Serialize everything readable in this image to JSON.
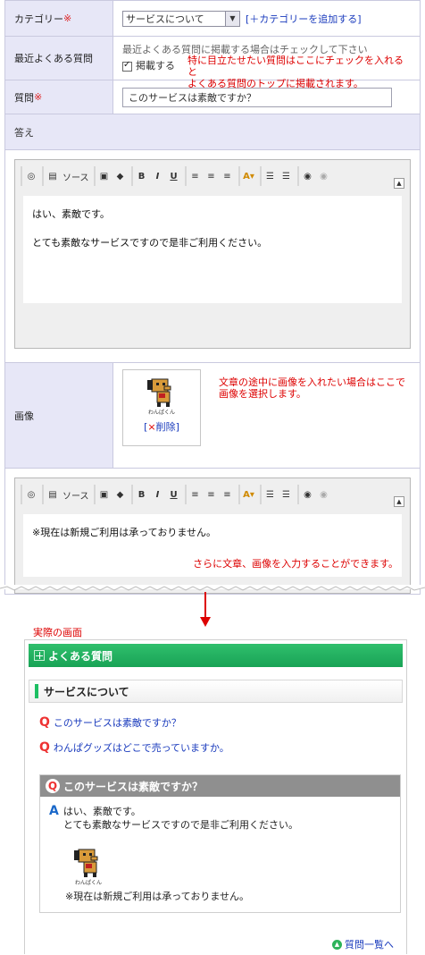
{
  "admin": {
    "category": {
      "label": "カテゴリー",
      "required": "※",
      "selected": "サービスについて",
      "add_link": "[＋カテゴリーを追加する]"
    },
    "recent": {
      "label": "最近よくある質問",
      "hint": "最近よくある質問に掲載する場合はチェックして下さい",
      "checkbox_label": "掲載する",
      "annotation_line1": "特に目立たせたい質問はここにチェックを入れると",
      "annotation_line2": "よくある質問のトップに掲載されます。"
    },
    "question": {
      "label": "質問",
      "required": "※",
      "value": "このサービスは素敵ですか？"
    },
    "answer": {
      "label": "答え"
    },
    "editor1": {
      "source_label": "ソース",
      "line1": "はい、素敵です。",
      "line2": "とても素敵なサービスですので是非ご利用ください。"
    },
    "image": {
      "label": "画像",
      "caption": "わんぱくん",
      "delete_label": "削除",
      "delete_x": "×",
      "annotation_line1": "文章の途中に画像を入れたい場合はここで",
      "annotation_line2": "画像を選択します。"
    },
    "editor2": {
      "source_label": "ソース",
      "line1": "※現在は新規ご利用は承っておりません。",
      "annotation": "さらに文章、画像を入力することができます。"
    }
  },
  "actual_label": "実際の画面",
  "site": {
    "header": "よくある質問",
    "section": "サービスについて",
    "questions": [
      "このサービスは素敵ですか？",
      "わんぱグッズはどこで売っていますか。"
    ],
    "answer_box": {
      "question": "このサービスは素敵ですか？",
      "a_mark": "A",
      "line1": "はい、素敵です。",
      "line2": "とても素敵なサービスですので是非ご利用ください。",
      "image_caption": "わんぱくん",
      "line3": "※現在は新規ご利用は承っておりません。"
    },
    "back_link": "質問一覧へ",
    "q_mark": "Q"
  },
  "colors": {
    "red_note": "#dd0000",
    "green": "#1dbf63",
    "link": "#1a3bbd",
    "label_bg": "#e7e7f7"
  }
}
